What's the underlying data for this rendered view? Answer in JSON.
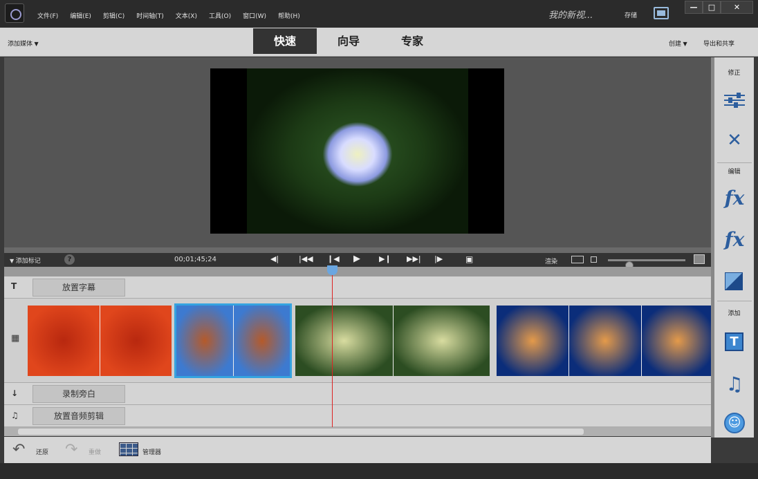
{
  "menu": [
    "文件(F)",
    "编辑(E)",
    "剪辑(C)",
    "时间轴(T)",
    "文本(X)",
    "工具(O)",
    "窗口(W)",
    "帮助(H)"
  ],
  "project": {
    "name": "我的新视..."
  },
  "header": {
    "save": "存储"
  },
  "modes": {
    "add_media": "添加媒体",
    "tabs": [
      "快速",
      "向导",
      "专家"
    ],
    "active": 0,
    "create": "创建",
    "export": "导出和共享"
  },
  "transport": {
    "add_marker": "添加标记",
    "help": "?",
    "timecode": "00;01;45;24",
    "render": "渲染",
    "zoom_level": 0.25
  },
  "tracks": {
    "title_btn": "放置字幕",
    "narration_btn": "录制旁白",
    "audio_btn": "放置音频剪辑"
  },
  "clips": [
    {
      "name": "flower-clip",
      "colors": [
        "#e0461c",
        "#b8280f"
      ]
    },
    {
      "name": "desert-clip",
      "colors": [
        "#3d7ad0",
        "#b55a2a"
      ],
      "selected": true
    },
    {
      "name": "hydrangea-clip",
      "colors": [
        "#2c4d22",
        "#d8dca0"
      ]
    },
    {
      "name": "jellyfish-clip",
      "colors": [
        "#0b2d7a",
        "#e49a4a"
      ]
    }
  ],
  "bottom": {
    "undo": "还原",
    "redo": "重做",
    "organizer": "管理器"
  },
  "right_panel": {
    "adjust_head": "修正",
    "edit_head": "编辑",
    "add_head": "添加",
    "fx": "fx",
    "title_glyph": "T",
    "music_glyph": "♫",
    "smile_glyph": "☺"
  },
  "window_controls": {
    "minimize": "—",
    "maximize": "□",
    "close": "✕"
  }
}
